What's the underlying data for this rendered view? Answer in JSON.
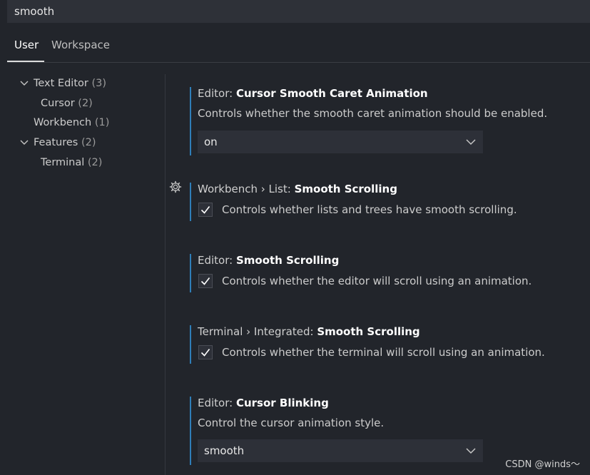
{
  "search": {
    "value": "smooth"
  },
  "tabs": [
    {
      "label": "User"
    },
    {
      "label": "Workspace"
    }
  ],
  "toc": [
    {
      "label": "Text Editor",
      "count": "(3)"
    },
    {
      "label": "Cursor",
      "count": "(2)"
    },
    {
      "label": "Workbench",
      "count": "(1)"
    },
    {
      "label": "Features",
      "count": "(2)"
    },
    {
      "label": "Terminal",
      "count": "(2)"
    }
  ],
  "settings": [
    {
      "category": "Editor: ",
      "name": "Cursor Smooth Caret Animation",
      "description": "Controls whether the smooth caret animation should be enabled.",
      "control": "select",
      "value": "on"
    },
    {
      "category": "Workbench › List: ",
      "name": "Smooth Scrolling",
      "description": "Controls whether lists and trees have smooth scrolling.",
      "control": "checkbox",
      "checked": true
    },
    {
      "category": "Editor: ",
      "name": "Smooth Scrolling",
      "description": "Controls whether the editor will scroll using an animation.",
      "control": "checkbox",
      "checked": true
    },
    {
      "category": "Terminal › Integrated: ",
      "name": "Smooth Scrolling",
      "description": "Controls whether the terminal will scroll using an animation.",
      "control": "checkbox",
      "checked": true
    },
    {
      "category": "Editor: ",
      "name": "Cursor Blinking",
      "description": "Control the cursor animation style.",
      "control": "select",
      "value": "smooth"
    }
  ],
  "icons": {
    "gear": "gear-icon",
    "chevron": "chevron-down-icon",
    "check": "check-icon"
  },
  "colors": {
    "accent": "#2f7eb8",
    "background": "#22252b"
  },
  "watermark": "CSDN @winds～"
}
